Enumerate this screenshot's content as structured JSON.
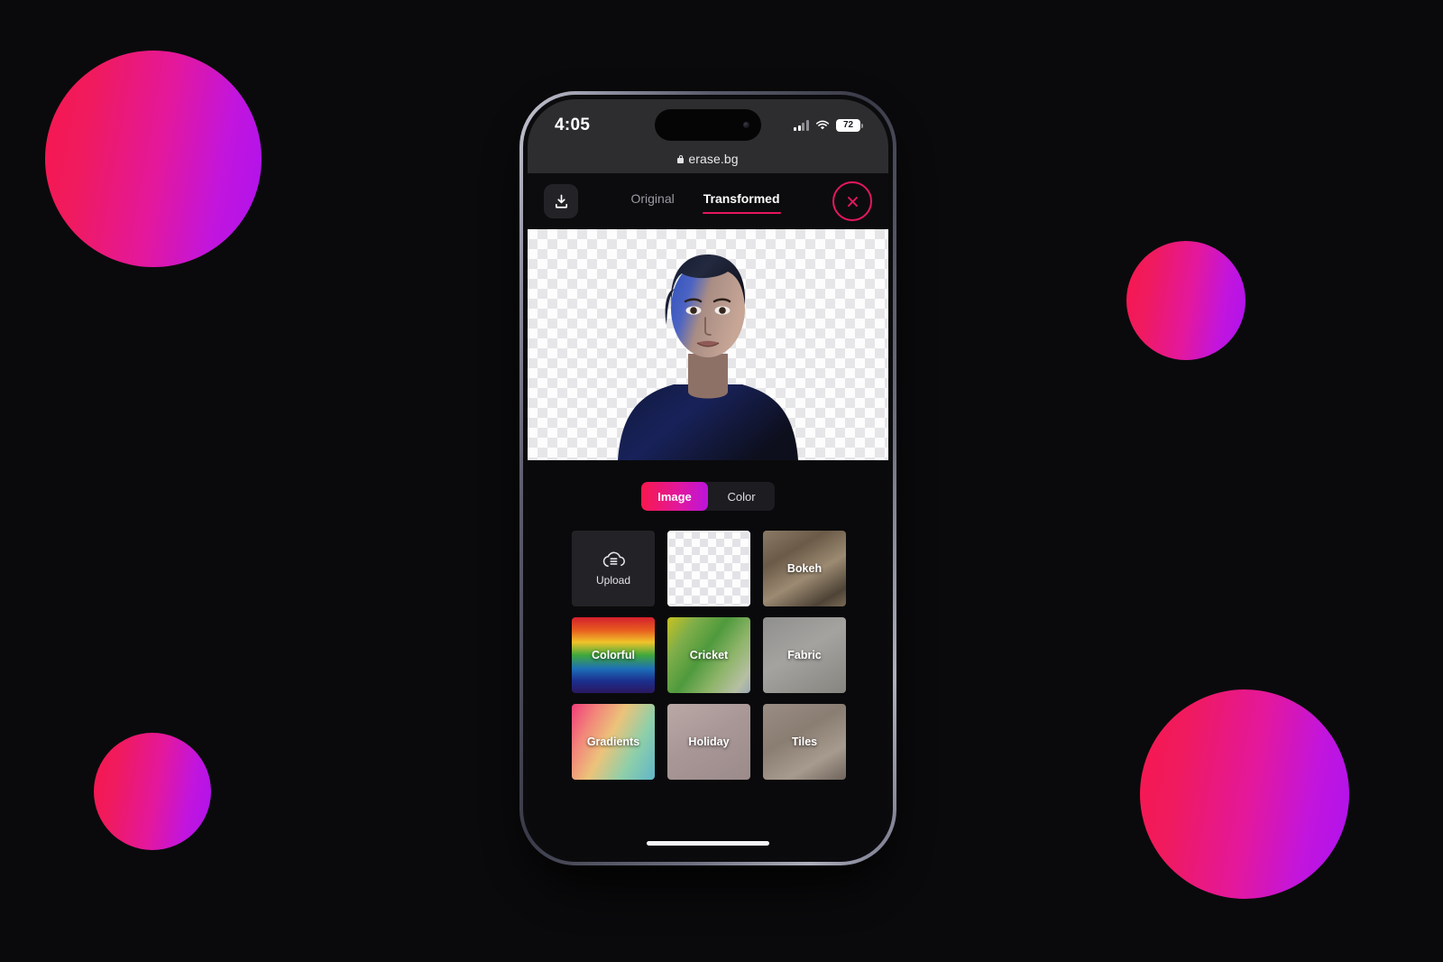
{
  "background": {
    "page_color": "#0a0a0c",
    "blob_gradient_start": "#f8184d",
    "blob_gradient_end": "#ae12f0"
  },
  "phone": {
    "status_bar": {
      "time": "4:05",
      "signal_icon": "cellular-signal-icon",
      "signal_bars_filled": 2,
      "signal_bars_total": 4,
      "wifi_icon": "wifi-icon",
      "battery_level": "72",
      "battery_icon": "battery-icon"
    },
    "browser": {
      "lock_icon": "lock-icon",
      "url": "erase.bg"
    },
    "home_indicator": "home-indicator"
  },
  "toolbar": {
    "download_icon": "download-icon",
    "close_icon": "close-icon",
    "tabs": [
      {
        "label": "Original",
        "active": false
      },
      {
        "label": "Transformed",
        "active": true
      }
    ],
    "active_accent": "#e5175f"
  },
  "preview": {
    "alt": "portrait-transparent-background",
    "checkerboard": true
  },
  "background_picker": {
    "segments": [
      {
        "label": "Image",
        "active": true
      },
      {
        "label": "Color",
        "active": false
      }
    ],
    "active_gradient_start": "#f8184d",
    "active_gradient_end": "#bc14dc",
    "thumbnails": [
      {
        "label": "Upload",
        "style": "upload",
        "icon": "cloud-upload-icon",
        "selected": false
      },
      {
        "label": "",
        "style": "transparent",
        "icon": "",
        "selected": true
      },
      {
        "label": "Bokeh",
        "style": "bokeh",
        "icon": "",
        "selected": false
      },
      {
        "label": "Colorful",
        "style": "colorful",
        "icon": "",
        "selected": false
      },
      {
        "label": "Cricket",
        "style": "cricket",
        "icon": "",
        "selected": false
      },
      {
        "label": "Fabric",
        "style": "fabric",
        "icon": "",
        "selected": false
      },
      {
        "label": "Gradients",
        "style": "gradients",
        "icon": "",
        "selected": false
      },
      {
        "label": "Holiday",
        "style": "holiday",
        "icon": "",
        "selected": false
      },
      {
        "label": "Tiles",
        "style": "tiles",
        "icon": "",
        "selected": false
      }
    ]
  }
}
